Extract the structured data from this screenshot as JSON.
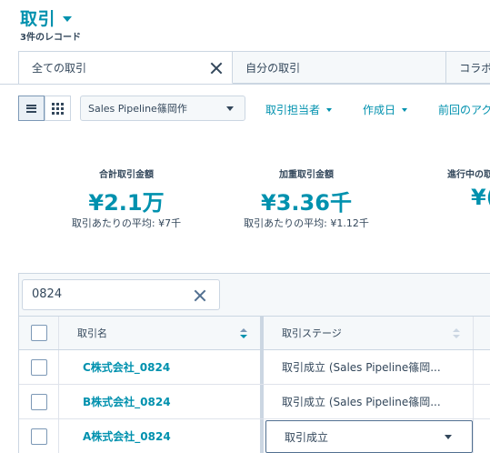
{
  "header": {
    "title": "取引",
    "record_count": "3件のレコード"
  },
  "tabs": [
    {
      "label": "全ての取引",
      "active": true
    },
    {
      "label": "自分の取引",
      "active": false
    },
    {
      "label": "コラボ",
      "active": false
    }
  ],
  "toolbar": {
    "pipeline": "Sales Pipeline篠岡作",
    "filters": [
      "取引担当者",
      "作成日",
      "前回のアク"
    ]
  },
  "metrics": [
    {
      "label": "合計取引金額",
      "value": "¥2.1万",
      "avg": "取引あたりの平均: ¥7千"
    },
    {
      "label": "加重取引金額",
      "value": "¥3.36千",
      "avg": "取引あたりの平均: ¥1.12千"
    },
    {
      "label": "進行中の取",
      "value": "¥(",
      "avg": ""
    }
  ],
  "search": {
    "value": "0824"
  },
  "table": {
    "columns": [
      "取引名",
      "取引ステージ"
    ],
    "rows": [
      {
        "name": "C株式会社_0824",
        "stage": "取引成立 (Sales Pipeline篠岡..."
      },
      {
        "name": "B株式会社_0824",
        "stage": "取引成立 (Sales Pipeline篠岡..."
      },
      {
        "name": "A株式会社_0824",
        "stage": "取引成立"
      }
    ]
  },
  "colors": {
    "accent": "#0091ae",
    "text": "#33475b",
    "border": "#cbd6e2"
  }
}
